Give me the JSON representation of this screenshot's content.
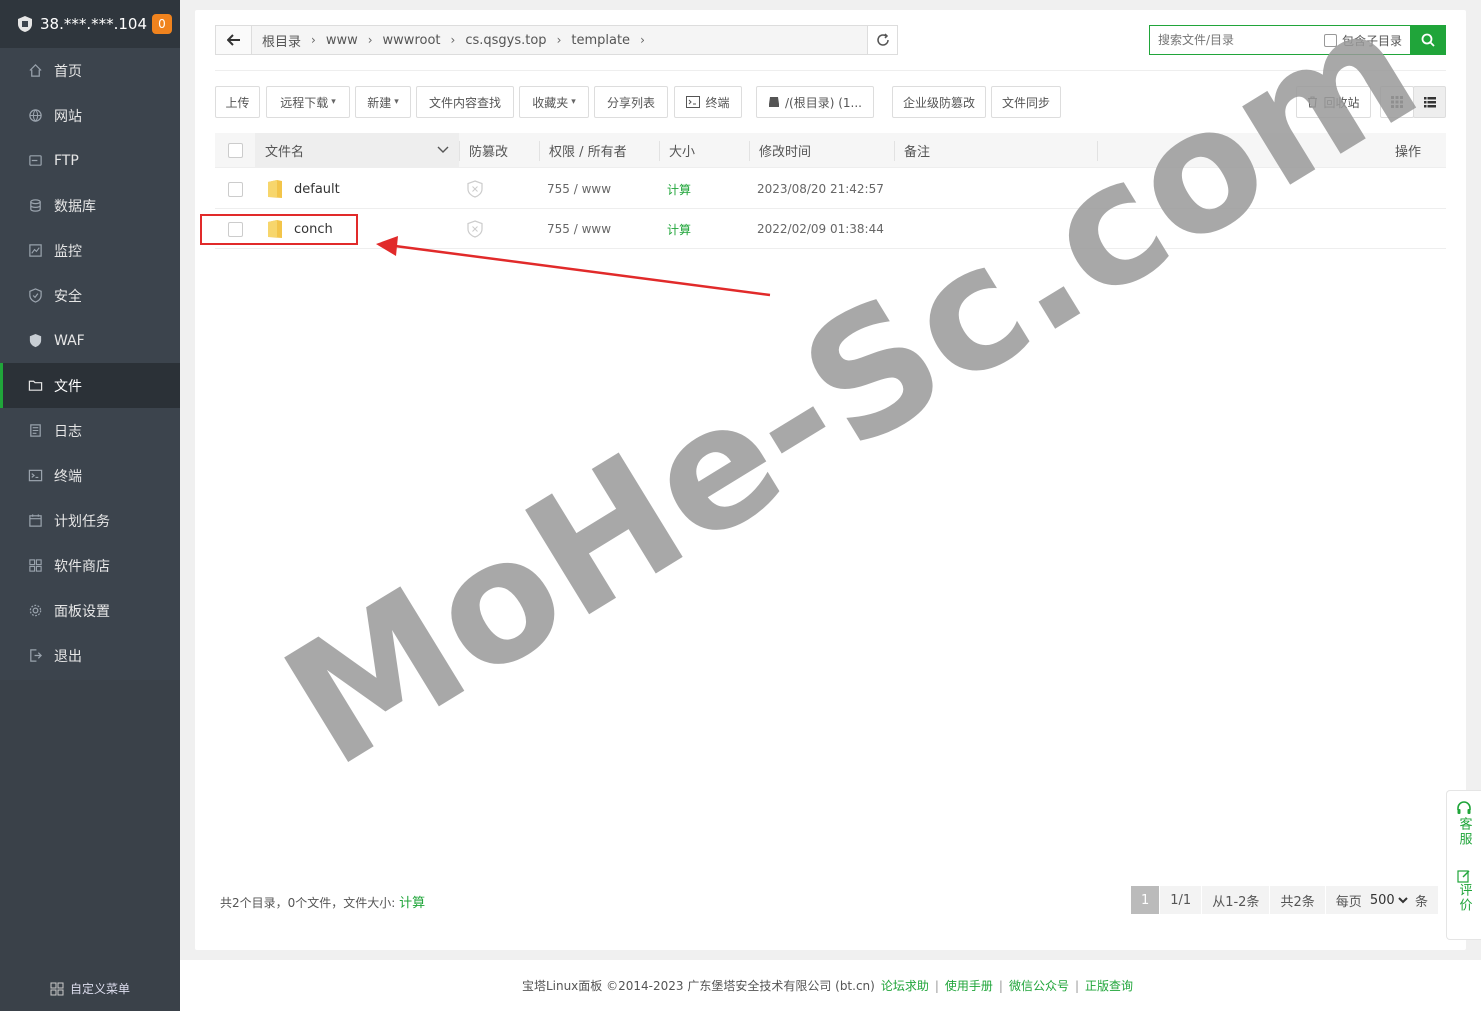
{
  "sidebar": {
    "server_ip": "38.***.***.104",
    "badge": "0",
    "items": [
      {
        "label": "首页",
        "icon": "home-icon"
      },
      {
        "label": "网站",
        "icon": "globe-icon"
      },
      {
        "label": "FTP",
        "icon": "ftp-icon"
      },
      {
        "label": "数据库",
        "icon": "database-icon"
      },
      {
        "label": "监控",
        "icon": "monitor-icon"
      },
      {
        "label": "安全",
        "icon": "shield-icon"
      },
      {
        "label": "WAF",
        "icon": "waf-shield-icon"
      },
      {
        "label": "文件",
        "icon": "folder-icon"
      },
      {
        "label": "日志",
        "icon": "log-icon"
      },
      {
        "label": "终端",
        "icon": "terminal-icon"
      },
      {
        "label": "计划任务",
        "icon": "calendar-icon"
      },
      {
        "label": "软件商店",
        "icon": "apps-icon"
      },
      {
        "label": "面板设置",
        "icon": "gear-icon"
      },
      {
        "label": "退出",
        "icon": "logout-icon"
      }
    ],
    "active": "文件",
    "custom_menu": "自定义菜单"
  },
  "path": {
    "crumbs": [
      "根目录",
      "www",
      "wwwroot",
      "cs.qsgys.top",
      "template"
    ]
  },
  "search": {
    "placeholder": "搜索文件/目录",
    "include_sub": "包含子目录"
  },
  "toolbar": {
    "upload": "上传",
    "remote_download": "远程下载",
    "new": "新建",
    "content_search": "文件内容查找",
    "favorites": "收藏夹",
    "share_list": "分享列表",
    "terminal": "终端",
    "disk": "/(根目录) (1...",
    "tamper": "企业级防篡改",
    "sync": "文件同步",
    "recycle": "回收站"
  },
  "table": {
    "headers": {
      "name": "文件名",
      "tamper": "防篡改",
      "perm": "权限 / 所有者",
      "size": "大小",
      "mtime": "修改时间",
      "note": "备注",
      "ops": "操作"
    },
    "rows": [
      {
        "name": "default",
        "perm": "755 / www",
        "size": "计算",
        "mtime": "2023/08/20 21:42:57"
      },
      {
        "name": "conch",
        "perm": "755 / www",
        "size": "计算",
        "mtime": "2022/02/09 01:38:44"
      }
    ]
  },
  "summary": {
    "text": "共2个目录，0个文件，文件大小: ",
    "calc": "计算"
  },
  "pager": {
    "current": "1",
    "pages": "1/1",
    "range": "从1-2条",
    "total": "共2条",
    "per_page_label": "每页",
    "per_page": "500",
    "unit": "条"
  },
  "float": {
    "service": "客服",
    "review": "评价"
  },
  "watermark": "MoHe-Sc.com",
  "footer": {
    "text": "宝塔Linux面板 ©2014-2023 广东堡塔安全技术有限公司 (bt.cn)",
    "links": [
      "论坛求助",
      "使用手册",
      "微信公众号",
      "正版查询"
    ]
  },
  "colors": {
    "accent": "#20a53a",
    "sidebar": "#3c444d",
    "highlight": "#e12a2a",
    "badge": "#f0831e"
  }
}
